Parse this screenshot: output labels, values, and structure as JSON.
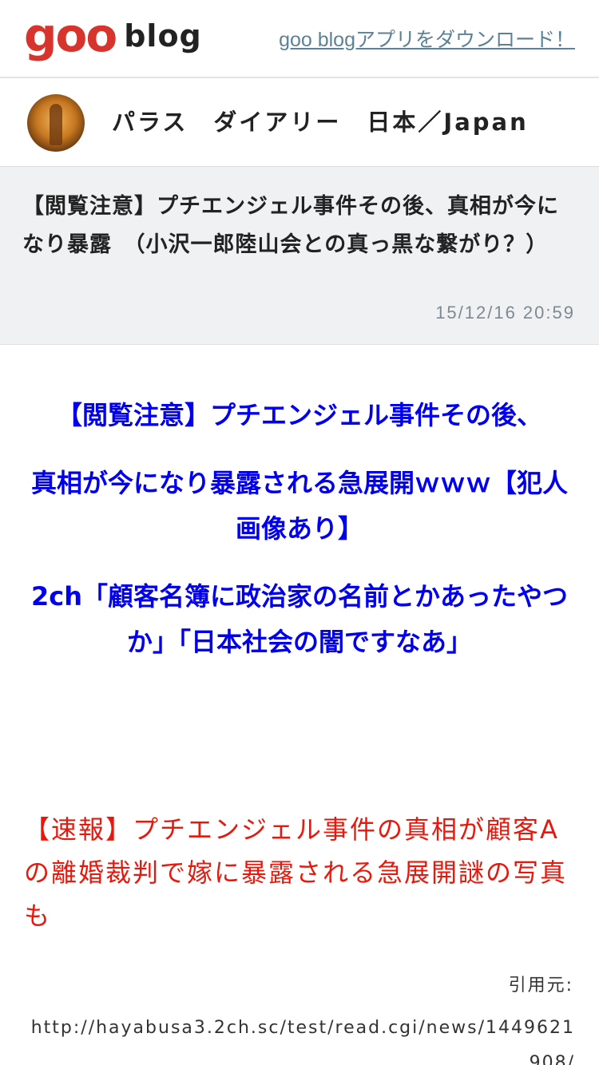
{
  "header": {
    "logo_goo": "goo",
    "logo_blog": "blog",
    "app_link": "goo blogアプリをダウンロード！"
  },
  "blog": {
    "title": "パラス　ダイアリー　日本／Japan"
  },
  "article": {
    "title": "【閲覧注意】プチエンジェル事件その後、真相が今になり暴露　（小沢一郎陸山会との真っ黒な繋がり？）",
    "date": "15/12/16 20:59"
  },
  "content": {
    "headlines": [
      "【閲覧注意】プチエンジェル事件その後、",
      "真相が今になり暴露される急展開ｗｗｗ【犯人画像あり】",
      "2ch「顧客名簿に政治家の名前とかあったやつか」「日本社会の闇ですなあ」"
    ],
    "news_text": "【速報】プチエンジェル事件の真相が顧客Aの離婚裁判で嫁に暴露される急展開謎の写真も",
    "source_label": "引用元:",
    "source_url": "http://hayabusa3.2ch.sc/test/read.cgi/news/1449621908/"
  },
  "colors": {
    "brand_red": "#d8342e",
    "link": "#5b8296",
    "headline_blue": "#0000ee",
    "news_red": "#e8180c"
  }
}
